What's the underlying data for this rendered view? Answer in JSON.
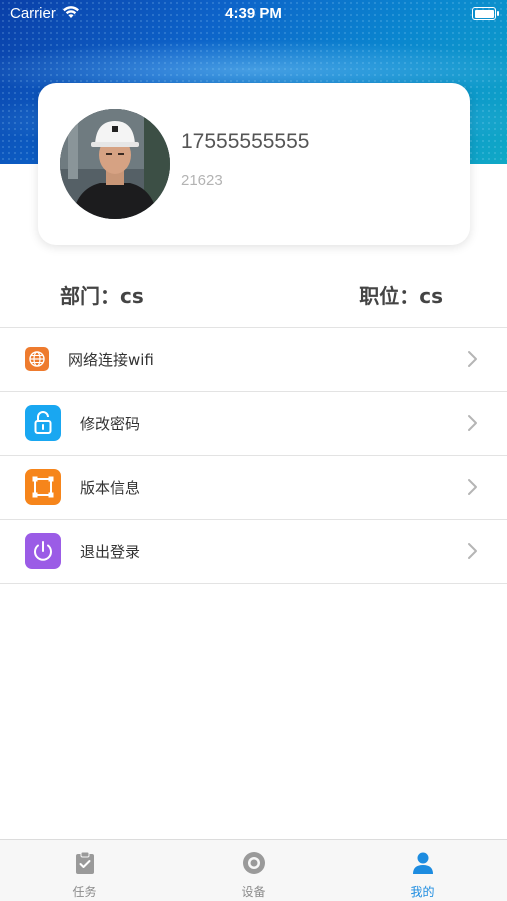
{
  "status_bar": {
    "carrier": "Carrier",
    "time": "4:39 PM"
  },
  "profile": {
    "phone": "17555555555",
    "user_id": "21623"
  },
  "info": {
    "department": "部门：cs",
    "position": "职位：cs"
  },
  "menu": [
    {
      "label": "网络连接wifi",
      "icon": "globe-icon",
      "color": "#ee7b2e"
    },
    {
      "label": "修改密码",
      "icon": "lock-icon",
      "color": "#19a7f1"
    },
    {
      "label": "版本信息",
      "icon": "crop-frame-icon",
      "color": "#f6851b"
    },
    {
      "label": "退出登录",
      "icon": "power-icon",
      "color": "#9b5ce6"
    }
  ],
  "tabs": [
    {
      "label": "任务",
      "icon": "clipboard-icon",
      "active": false
    },
    {
      "label": "设备",
      "icon": "device-icon",
      "active": false
    },
    {
      "label": "我的",
      "icon": "person-icon",
      "active": true
    }
  ],
  "colors": {
    "accent": "#1d8ce0",
    "header_start": "#0a3fa8",
    "header_end": "#10a9c6"
  }
}
